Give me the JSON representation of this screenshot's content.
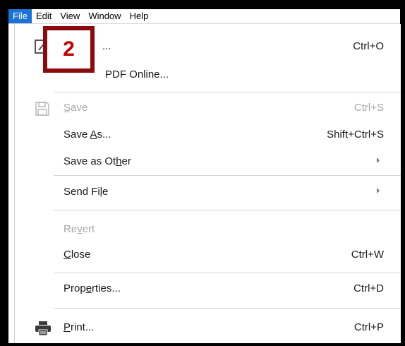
{
  "menubar": {
    "items": [
      {
        "label": "File",
        "active": true
      },
      {
        "label": "Edit"
      },
      {
        "label": "View"
      },
      {
        "label": "Window"
      },
      {
        "label": "Help"
      }
    ]
  },
  "file_menu": {
    "open": {
      "label_suffix": "...",
      "shortcut": "Ctrl+O"
    },
    "open_online": {
      "label_suffix": "PDF Online..."
    },
    "save": {
      "pre": "",
      "u": "S",
      "post": "ave",
      "shortcut": "Ctrl+S"
    },
    "save_as": {
      "pre": "Save ",
      "u": "A",
      "post": "s...",
      "shortcut": "Shift+Ctrl+S"
    },
    "save_as_other": {
      "pre": "Save as Ot",
      "u": "h",
      "post": "er"
    },
    "send_file": {
      "pre": "Send Fi",
      "u": "l",
      "post": "e"
    },
    "revert": {
      "pre": "Re",
      "u": "v",
      "post": "ert"
    },
    "close": {
      "pre": "",
      "u": "C",
      "post": "lose",
      "shortcut": "Ctrl+W"
    },
    "properties": {
      "pre": "Prop",
      "u": "e",
      "post": "rties...",
      "shortcut": "Ctrl+D"
    },
    "print": {
      "pre": "",
      "u": "P",
      "post": "rint...",
      "shortcut": "Ctrl+P"
    }
  },
  "annotation": {
    "step_number": "2"
  },
  "colors": {
    "menubar_active": "#1a74d8",
    "badge_border": "#8b0a0a",
    "badge_text": "#c00000",
    "disabled_text": "#a8a8a8"
  },
  "icons": [
    "edit-pdf-icon",
    "save-disk-icon",
    "printer-icon",
    "submenu-arrow-icon"
  ]
}
